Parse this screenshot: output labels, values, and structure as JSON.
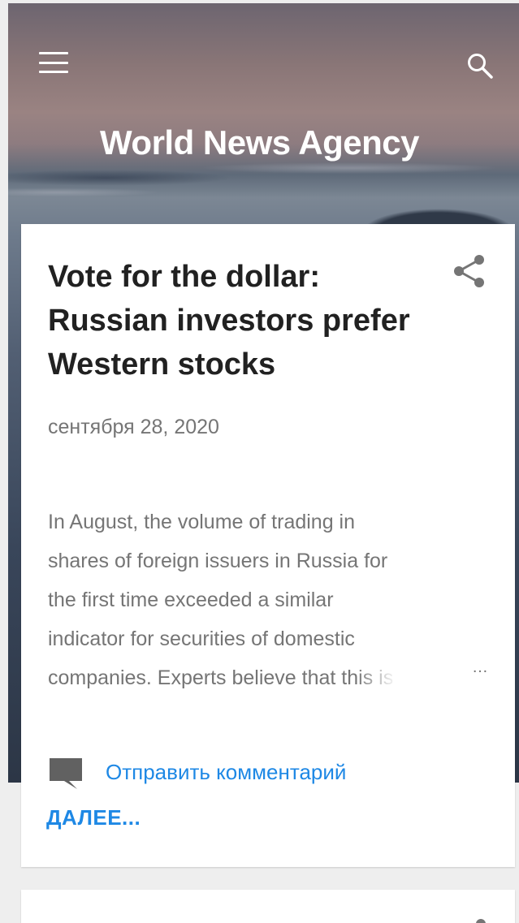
{
  "header": {
    "site_title": "World News Agency",
    "menu_icon": "hamburger-menu-icon",
    "search_icon": "search-icon"
  },
  "post": {
    "title": "Vote for the dollar: Russian investors prefer Western stocks",
    "date": "сентября 28, 2020",
    "snippet_lines": [
      "In August, the volume of trading in",
      "shares of foreign issuers in Russia for",
      "the first time exceeded a similar",
      "indicator for securities of domestic"
    ],
    "snippet_last_line_start": "companies. Experts believe that",
    "snippet_last_line_faded": " this is",
    "ellipsis": "…",
    "share_icon": "share-icon",
    "comment_icon": "comment-icon",
    "comment_link": "Отправить комментарий",
    "more_link": "ДАЛЕЕ..."
  },
  "colors": {
    "link": "#1e88e5",
    "title_text": "#212121",
    "meta_text": "#757575",
    "page_bg": "#eeeeee",
    "card_bg": "#ffffff"
  }
}
